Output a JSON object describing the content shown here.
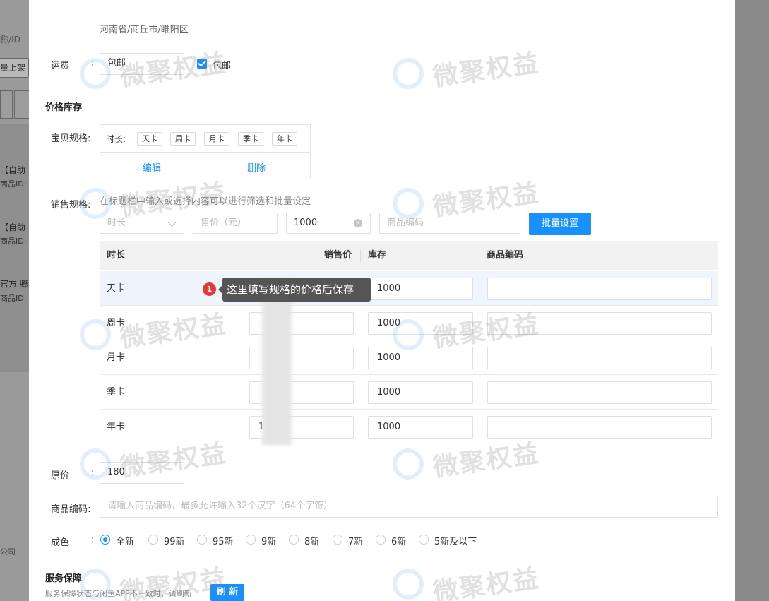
{
  "background": {
    "search_placeholder": "称/ID",
    "bulk_button": "量上架",
    "tab_fragment": "",
    "list_items": [
      {
        "title": "【自助",
        "sub": "商品ID:"
      },
      {
        "title": "【自助",
        "sub": "商品ID:"
      },
      {
        "title": "官方 腾",
        "sub": "商品ID:"
      }
    ],
    "company_fragment": "公司"
  },
  "address": {
    "text": "河南省/商丘市/睢阳区"
  },
  "shipping": {
    "label": "运费",
    "colon": ":",
    "input_value": "包邮",
    "checkbox_label": "包邮",
    "checked": true
  },
  "price_section": {
    "title": "价格库存"
  },
  "spec": {
    "label": "宝贝规格:",
    "group_label": "时长:",
    "tags": [
      "天卡",
      "周卡",
      "月卡",
      "季卡",
      "年卡"
    ],
    "edit": "编辑",
    "delete": "删除"
  },
  "sales_spec": {
    "label": "销售规格:",
    "hint": "在标题栏中输入或选择内容可以进行筛选和批量设定",
    "filter_duration_placeholder": "时长",
    "filter_price_placeholder": "售价（元）",
    "filter_stock_value": "1000",
    "filter_code_placeholder": "商品编码",
    "batch_button": "批量设置"
  },
  "table": {
    "headers": [
      "时长",
      "销售价",
      "库存",
      "商品编码"
    ],
    "rows": [
      {
        "name": "天卡",
        "price": "",
        "stock": "1000",
        "code": ""
      },
      {
        "name": "周卡",
        "price": "",
        "stock": "1000",
        "code": ""
      },
      {
        "name": "月卡",
        "price": "",
        "stock": "1000",
        "code": ""
      },
      {
        "name": "季卡",
        "price": "",
        "stock": "1000",
        "code": ""
      },
      {
        "name": "年卡",
        "price": "1",
        "stock": "1000",
        "code": ""
      }
    ]
  },
  "tooltip": {
    "badge": "1",
    "text": "这里填写规格的价格后保存"
  },
  "original_price": {
    "label": "原价",
    "colon": ":",
    "value": "180"
  },
  "product_code": {
    "label": "商品编码:",
    "placeholder": "请输入商品编码，最多允许输入32个汉字（64个字符）"
  },
  "condition": {
    "label": "成色",
    "colon": ":",
    "options": [
      "全新",
      "99新",
      "95新",
      "9新",
      "8新",
      "7新",
      "6新",
      "5新及以下"
    ],
    "selected": "全新"
  },
  "service": {
    "title": "服务保障",
    "hint": "服务保障状态与闲鱼APP不一致时，请刷新",
    "refresh_button": "刷 新"
  },
  "watermark": {
    "text": "微聚权益"
  },
  "colors": {
    "primary": "#1890ff",
    "badge": "#e53935",
    "tooltip_bg": "#555555"
  }
}
